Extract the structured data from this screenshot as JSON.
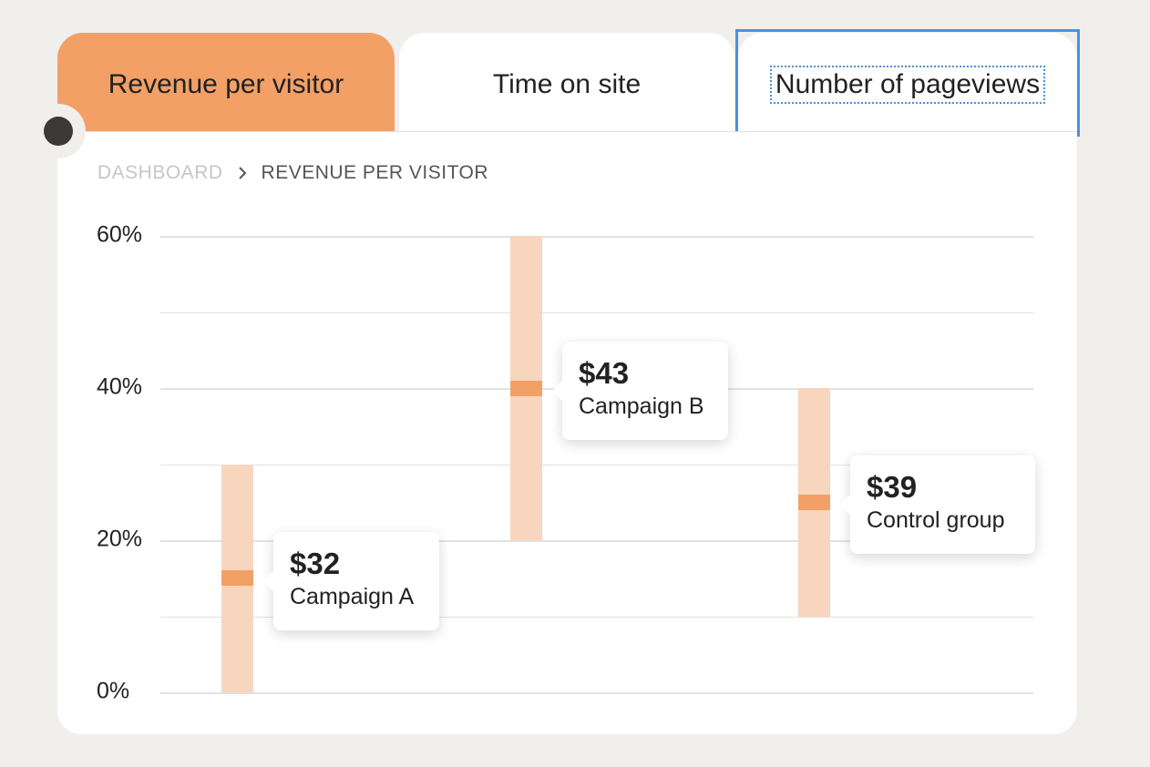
{
  "tabs": [
    {
      "label": "Revenue per visitor",
      "active": true
    },
    {
      "label": "Time on site",
      "active": false
    },
    {
      "label": "Number of pageviews",
      "active": false,
      "focused": true
    }
  ],
  "breadcrumb": {
    "root": "DASHBOARD",
    "current": "REVENUE PER VISITOR"
  },
  "colors": {
    "accent": "#f2a066",
    "range": "#f7d6bd",
    "focus": "#4a90e2",
    "background": "#f0efeb"
  },
  "chart_data": {
    "type": "range",
    "y_ticks": [
      "60%",
      "40%",
      "20%",
      "0%"
    ],
    "ylim": [
      0,
      60
    ],
    "grid": true,
    "series": [
      {
        "label": "Campaign A",
        "value_label": "$32",
        "low": 0,
        "high": 30,
        "marker": 15
      },
      {
        "label": "Campaign B",
        "value_label": "$43",
        "low": 20,
        "high": 60,
        "marker": 40
      },
      {
        "label": "Control group",
        "value_label": "$39",
        "low": 10,
        "high": 40,
        "marker": 25
      }
    ]
  }
}
